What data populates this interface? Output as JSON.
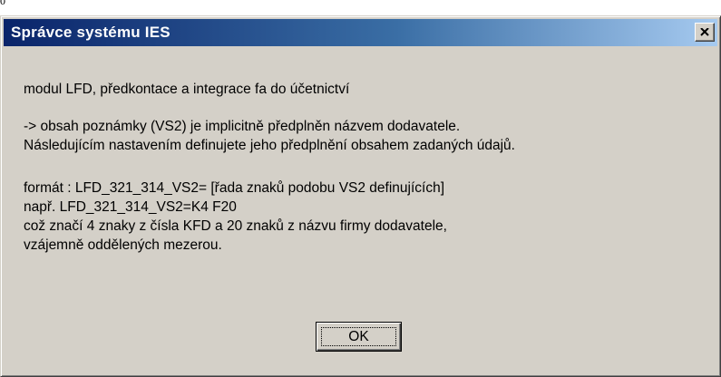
{
  "corner_glyph": "0",
  "window": {
    "title": "Správce systému IES",
    "close_icon": "close-icon"
  },
  "message": {
    "lines": [
      "modul LFD, předkontace a integrace fa do účetnictví",
      "-> obsah poznámky (VS2) je implicitně předplněn názvem dodavatele.",
      "Následujícím nastavením definujete jeho předplnění obsahem zadaných údajů.",
      "formát : LFD_321_314_VS2= [řada znaků podobu VS2 definujících]",
      "např. LFD_321_314_VS2=K4 F20",
      "což značí 4 znaky z čísla KFD a 20 znaků z názvu firmy dodavatele,",
      "vzájemně oddělených mezerou."
    ]
  },
  "ok_button": {
    "label": "OK"
  },
  "colors": {
    "dialog_face": "#d4d0c8",
    "title_start": "#0a246a",
    "title_end": "#a6caf0",
    "title_text": "#ffffff"
  }
}
